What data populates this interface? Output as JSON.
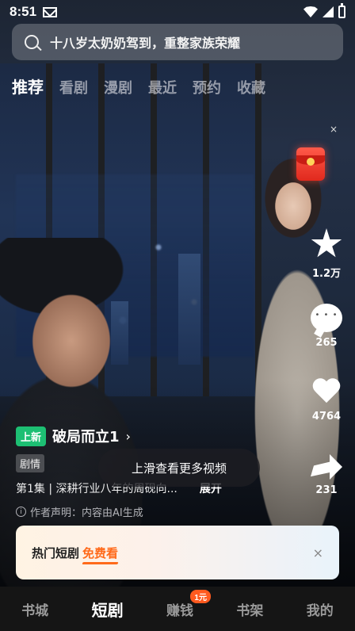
{
  "status_bar": {
    "time": "8:51"
  },
  "search": {
    "text": "十八岁太奶奶驾到，重整家族荣耀"
  },
  "tabs": [
    {
      "label": "推荐",
      "active": true
    },
    {
      "label": "看剧"
    },
    {
      "label": "漫剧"
    },
    {
      "label": "最近"
    },
    {
      "label": "预约"
    },
    {
      "label": "收藏"
    }
  ],
  "actions": {
    "close_label": "×",
    "favorite_count": "1.2万",
    "comment_count": "265",
    "like_count": "4764",
    "share_count": "231"
  },
  "video": {
    "badge": "上新",
    "title": "破局而立1",
    "chevron": "›",
    "genre": "剧情",
    "episode": "第1集 | 深耕行业八年的周砚向...",
    "expand": "展开",
    "disclaimer": "作者声明：内容由AI生成",
    "info_icon": "i"
  },
  "swipe_hint": "上滑查看更多视频",
  "promo": {
    "title": "热门短剧",
    "free": "免费看",
    "close": "×"
  },
  "bottom_nav": [
    {
      "label": "书城"
    },
    {
      "label": "短剧",
      "active": true
    },
    {
      "label": "赚钱",
      "badge": "1元"
    },
    {
      "label": "书架"
    },
    {
      "label": "我的"
    }
  ],
  "colors": {
    "new_badge": "#1dbf73",
    "promo_accent": "#ff6a1a",
    "nav_badge": "#ff5a1f"
  }
}
